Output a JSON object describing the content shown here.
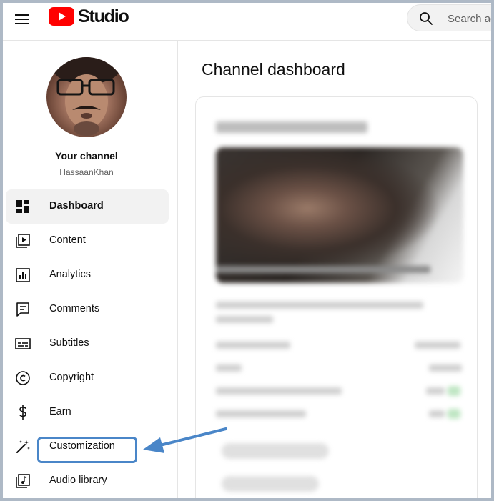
{
  "header": {
    "logo_text": "Studio",
    "search_placeholder": "Search across your channel",
    "search_visible_text": "Search ac"
  },
  "channel": {
    "title": "Your channel",
    "handle": "HassaanKhan"
  },
  "sidebar": {
    "items": [
      {
        "label": "Dashboard",
        "icon": "dashboard-icon",
        "active": true
      },
      {
        "label": "Content",
        "icon": "content-icon",
        "active": false
      },
      {
        "label": "Analytics",
        "icon": "analytics-icon",
        "active": false
      },
      {
        "label": "Comments",
        "icon": "comments-icon",
        "active": false
      },
      {
        "label": "Subtitles",
        "icon": "subtitles-icon",
        "active": false
      },
      {
        "label": "Copyright",
        "icon": "copyright-icon",
        "active": false
      },
      {
        "label": "Earn",
        "icon": "earn-icon",
        "active": false
      },
      {
        "label": "Customization",
        "icon": "customization-icon",
        "active": false,
        "highlighted": true
      },
      {
        "label": "Audio library",
        "icon": "audio-library-icon",
        "active": false
      }
    ]
  },
  "main": {
    "title": "Channel dashboard"
  },
  "colors": {
    "brand_red": "#ff0000",
    "highlight": "#4a86c8",
    "active_bg": "#f2f2f2",
    "frame_border": "#aeb9c6"
  }
}
